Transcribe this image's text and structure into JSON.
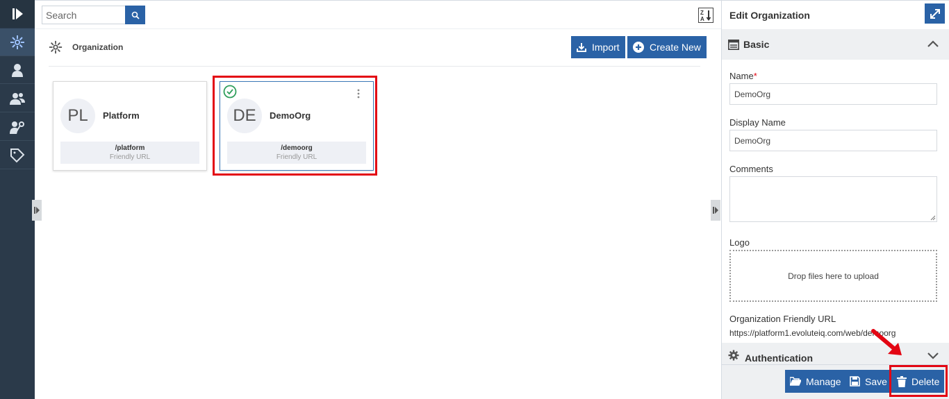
{
  "sidebar": {
    "items": [
      {
        "icon": "logo-icon"
      },
      {
        "icon": "organization-icon"
      },
      {
        "icon": "user-icon"
      },
      {
        "icon": "users-group-icon"
      },
      {
        "icon": "user-key-icon"
      },
      {
        "icon": "tag-icon"
      }
    ]
  },
  "search": {
    "placeholder": "Search"
  },
  "sort": {
    "icon": "sort-z-a-icon"
  },
  "main": {
    "title": "Organization",
    "import_label": "Import",
    "create_label": "Create New"
  },
  "cards": [
    {
      "initials": "PL",
      "name": "Platform",
      "url": "/platform",
      "url_caption": "Friendly URL",
      "selected": false
    },
    {
      "initials": "DE",
      "name": "DemoOrg",
      "url": "/demoorg",
      "url_caption": "Friendly URL",
      "selected": true
    }
  ],
  "panel": {
    "title": "Edit Organization",
    "basic_label": "Basic",
    "name_label": "Name",
    "name_required": "*",
    "name_value": "DemoOrg",
    "display_name_label": "Display Name",
    "display_name_value": "DemoOrg",
    "comments_label": "Comments",
    "logo_label": "Logo",
    "dropzone_text": "Drop files here to upload",
    "friendly_url_label": "Organization Friendly URL",
    "friendly_url_value": "https://platform1.evoluteiq.com/web/demoorg",
    "auth_label": "Authentication",
    "manage_label": "Manage",
    "save_label": "Save",
    "delete_label": "Delete"
  },
  "colors": {
    "sidebar": "#2b3a4a",
    "accent": "#2a62a6",
    "highlight": "#e30613",
    "success": "#2e9e5b"
  }
}
